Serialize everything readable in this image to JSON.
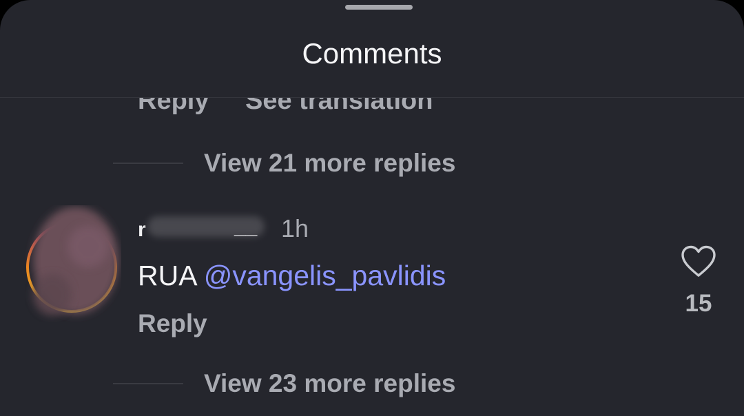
{
  "sheet": {
    "title": "Comments"
  },
  "previous_comment": {
    "reply_label": "Reply",
    "translate_label": "See translation",
    "view_replies_label": "View 21 more replies"
  },
  "comment": {
    "username_first": "r",
    "username_tail": "__",
    "time": "1h",
    "text_prefix": "RUA ",
    "mention": "@vangelis_pavlidis",
    "reply_label": "Reply",
    "like_count": "15",
    "view_replies_label": "View 23 more replies"
  },
  "colors": {
    "background": "#25262d",
    "mention": "#8a94ff",
    "secondary_text": "#a9abb2",
    "primary_text": "#f5f5f7"
  },
  "icons": {
    "like": "heart-outline-icon",
    "avatar": "blurred-avatar-with-story-ring"
  }
}
